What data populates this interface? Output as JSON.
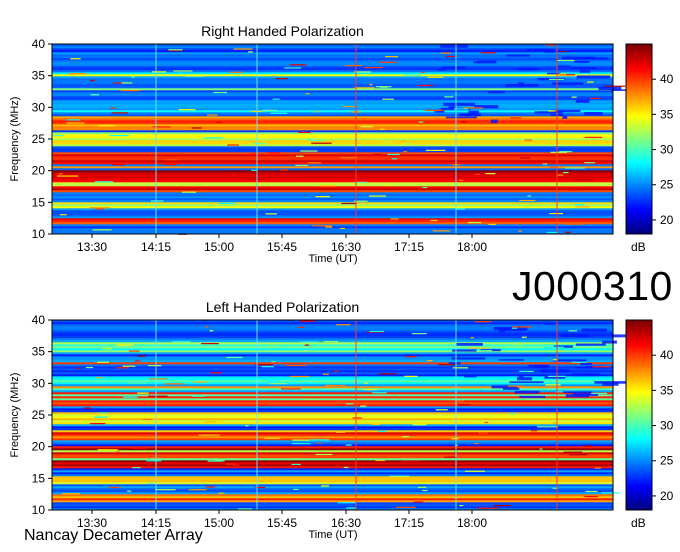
{
  "observation_id": "J000310",
  "footer_label": "Nancay Decameter Array",
  "chart_data": [
    {
      "type": "heatmap",
      "title": "Right Handed Polarization",
      "xlabel": "Time (UT)",
      "ylabel": "Frequency (MHz)",
      "x_ticks": [
        "13:30",
        "14:15",
        "15:00",
        "15:45",
        "16:30",
        "17:15",
        "18:00"
      ],
      "y_ticks": [
        10,
        15,
        20,
        25,
        30,
        35,
        40
      ],
      "ylim": [
        10,
        40
      ],
      "colorbar": {
        "label": "dB",
        "ticks": [
          20,
          25,
          30,
          35,
          40
        ],
        "range": [
          18,
          45
        ]
      },
      "bands": [
        {
          "lo": 11.5,
          "hi": 12.5,
          "value": 40
        },
        {
          "lo": 14,
          "hi": 15,
          "value": 33
        },
        {
          "lo": 16.5,
          "hi": 20,
          "value": 42
        },
        {
          "lo": 21,
          "hi": 23,
          "value": 40
        },
        {
          "lo": 24,
          "hi": 26,
          "value": 34
        },
        {
          "lo": 26.5,
          "hi": 28.5,
          "value": 39
        },
        {
          "lo": 29,
          "hi": 31,
          "value": 27
        },
        {
          "lo": 34,
          "hi": 36,
          "value": 25
        }
      ]
    },
    {
      "type": "heatmap",
      "title": "Left Handed Polarization",
      "xlabel": "Time (UT)",
      "ylabel": "Frequency (MHz)",
      "x_ticks": [
        "13:30",
        "14:15",
        "15:00",
        "15:45",
        "16:30",
        "17:15",
        "18:00"
      ],
      "y_ticks": [
        10,
        15,
        20,
        25,
        30,
        35,
        40
      ],
      "ylim": [
        10,
        40
      ],
      "colorbar": {
        "label": "dB",
        "ticks": [
          20,
          25,
          30,
          35,
          40
        ],
        "range": [
          18,
          45
        ]
      },
      "bands": [
        {
          "lo": 11.5,
          "hi": 12.5,
          "value": 39
        },
        {
          "lo": 14,
          "hi": 15.5,
          "value": 34
        },
        {
          "lo": 16.5,
          "hi": 20,
          "value": 42
        },
        {
          "lo": 21,
          "hi": 22.5,
          "value": 40
        },
        {
          "lo": 23.5,
          "hi": 25.5,
          "value": 35
        },
        {
          "lo": 26.5,
          "hi": 28.5,
          "value": 39
        },
        {
          "lo": 29,
          "hi": 31,
          "value": 28
        },
        {
          "lo": 35,
          "hi": 36.5,
          "value": 30
        }
      ]
    }
  ]
}
